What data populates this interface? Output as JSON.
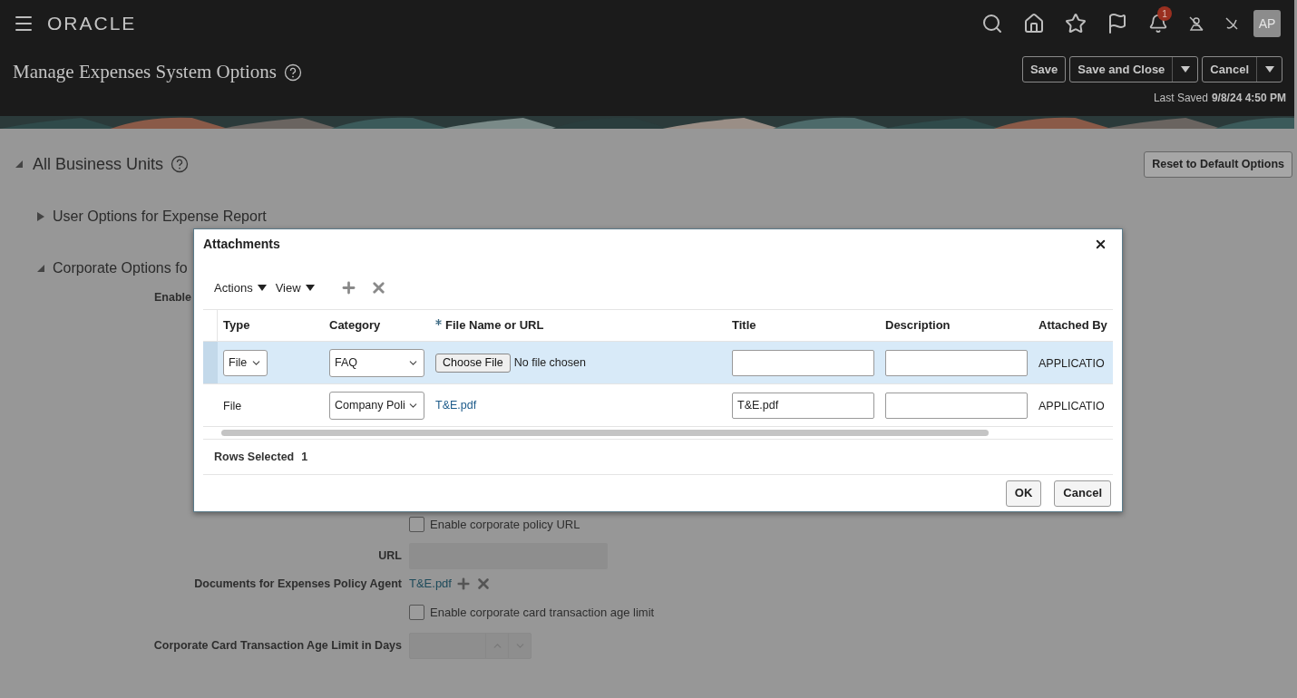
{
  "header": {
    "logo": "ORACLE",
    "notification_count": "1",
    "avatar": "AP",
    "page_title": "Manage Expenses System Options",
    "buttons": [
      {
        "label": "Save",
        "menu": false
      },
      {
        "label": "Save and Close",
        "menu": true
      },
      {
        "label": "Cancel",
        "menu": true
      }
    ],
    "last_saved_label": "Last Saved",
    "last_saved_value": "9/8/24 4:50 PM"
  },
  "section": {
    "title": "All Business Units",
    "expanded": true,
    "reset_button": "Reset to Default Options",
    "subsections": [
      {
        "title": "User Options for Expense Report",
        "expanded": false
      },
      {
        "title": "Corporate Options fo",
        "expanded": true
      }
    ]
  },
  "form": {
    "cut_label": "Enable",
    "rows": [
      {
        "kind": "checkbox",
        "label": "Enable corporate policy URL",
        "checked": false
      },
      {
        "kind": "field",
        "label": "URL"
      },
      {
        "kind": "documents",
        "label": "Documents for Expenses Policy Agent",
        "link": "T&E.pdf"
      },
      {
        "kind": "checkbox",
        "label": "Enable corporate card transaction age limit",
        "checked": false
      },
      {
        "kind": "spinner",
        "label": "Corporate Card Transaction Age Limit in Days"
      }
    ]
  },
  "dialog": {
    "title": "Attachments",
    "toolbar_menus": [
      "Actions",
      "View"
    ],
    "columns": [
      {
        "label": "Type",
        "required": false
      },
      {
        "label": "Category",
        "required": false
      },
      {
        "label": "File Name or URL",
        "required": true
      },
      {
        "label": "Title",
        "required": false
      },
      {
        "label": "Description",
        "required": false
      },
      {
        "label": "Attached By",
        "required": false
      }
    ],
    "rows": [
      {
        "selected": true,
        "type": "File",
        "type_editable": true,
        "category": "FAQ",
        "choose_button": "Choose File",
        "file_status": "No file chosen",
        "attached_by": "APPLICATIO"
      },
      {
        "selected": false,
        "type": "File",
        "type_editable": false,
        "category": "Company Poli",
        "file_link": "T&E.pdf",
        "title": "T&E.pdf",
        "attached_by": "APPLICATIO"
      }
    ],
    "rows_selected_label": "Rows Selected",
    "rows_selected_count": "1",
    "ok_button": "OK",
    "cancel_button": "Cancel"
  }
}
